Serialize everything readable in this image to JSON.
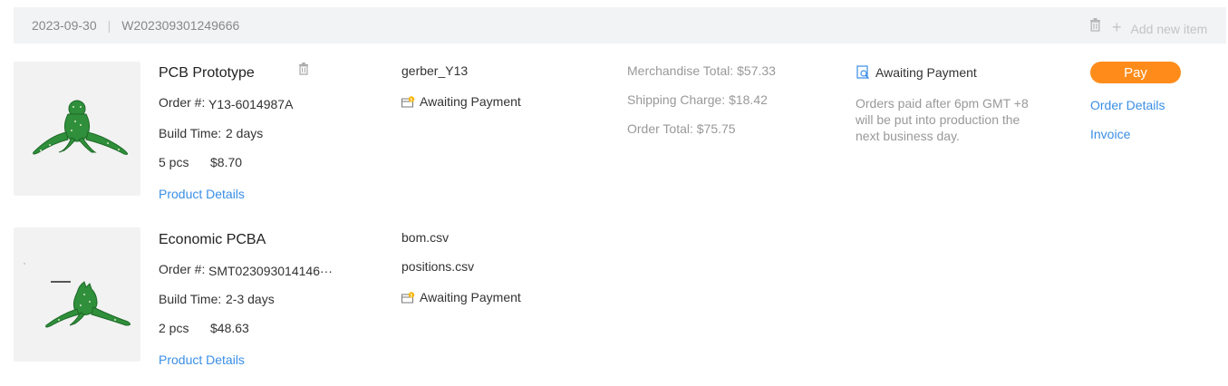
{
  "header": {
    "date": "2023-09-30",
    "separator": "|",
    "order_number": "W202309301249666",
    "add_label": "Add new item",
    "add_symbol": "+"
  },
  "items": [
    {
      "title": "PCB Prototype",
      "order_label": "Order #:",
      "order_value": "Y13-6014987A",
      "build_label": "Build Time:",
      "build_value": "2 days",
      "quantity": "5 pcs",
      "price": "$8.70",
      "details_link": "Product Details",
      "files": [
        "gerber_Y13"
      ],
      "status": "Awaiting Payment",
      "image_icon": "pcb-frog-image"
    },
    {
      "title": "Economic PCBA",
      "order_label": "Order #:",
      "order_value": "SMT023093014146···",
      "build_label": "Build Time:",
      "build_value": "2-3 days",
      "quantity": "2 pcs",
      "price": "$48.63",
      "details_link": "Product Details",
      "files": [
        "bom.csv",
        "positions.csv"
      ],
      "status": "Awaiting Payment",
      "image_icon": "pcba-frog-image"
    }
  ],
  "summary": {
    "merchandise_total": "Merchandise Total: $57.33",
    "shipping_charge": "Shipping Charge: $18.42",
    "order_total": "Order Total: $75.75"
  },
  "payment": {
    "status": "Awaiting Payment",
    "note": "Orders paid after 6pm GMT +8 will be put into production the next business day.",
    "pay_label": "Pay",
    "order_details_link": "Order Details",
    "invoice_link": "Invoice"
  },
  "colors": {
    "accent_orange": "#ff8c1a",
    "link_blue": "#3a8ee6",
    "header_bg": "#f2f3f5",
    "pcb_green": "#2f8f3a"
  }
}
